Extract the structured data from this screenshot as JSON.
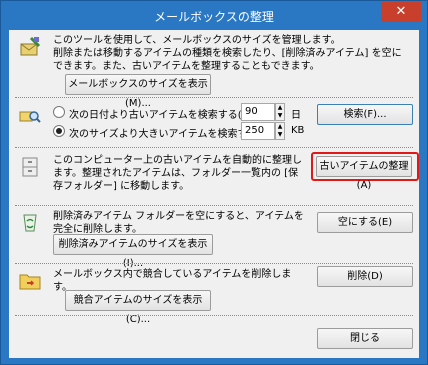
{
  "window": {
    "title": "メールボックスの整理",
    "close_glyph": "✕"
  },
  "section1": {
    "line1": "このツールを使用して、メールボックスのサイズを管理します。",
    "line2": "削除または移動するアイテムの種類を検索したり、[削除済みアイテム] を空にできます。また、古いアイテムを整理することもできます。",
    "button": "メールボックスのサイズを表示(M)..."
  },
  "section2": {
    "radio1": "次の日付より古いアイテムを検索する(O)",
    "radio1_value": "90",
    "radio1_unit": "日",
    "radio2": "次のサイズより大きいアイテムを検索する(L)",
    "radio2_value": "250",
    "radio2_unit": "KB",
    "search_button": "検索(F)..."
  },
  "section3": {
    "text": "このコンピューター上の古いアイテムを自動的に整理します。整理されたアイテムは、フォルダー一覧内の [保存フォルダー] に移動します。",
    "button": "古いアイテムの整理(A)"
  },
  "section4": {
    "text": "削除済みアイテム フォルダーを空にすると、アイテムを完全に削除します。",
    "button": "削除済みアイテムのサイズを表示(I)...",
    "empty_button": "空にする(E)"
  },
  "section5": {
    "text": "メールボックス内で競合しているアイテムを削除します。",
    "button": "競合アイテムのサイズを表示(C)...",
    "delete_button": "削除(D)"
  },
  "footer": {
    "close_button": "閉じる"
  },
  "colors": {
    "titlebar": "#2a78c4",
    "close": "#c8402c",
    "highlight": "#e01818"
  }
}
